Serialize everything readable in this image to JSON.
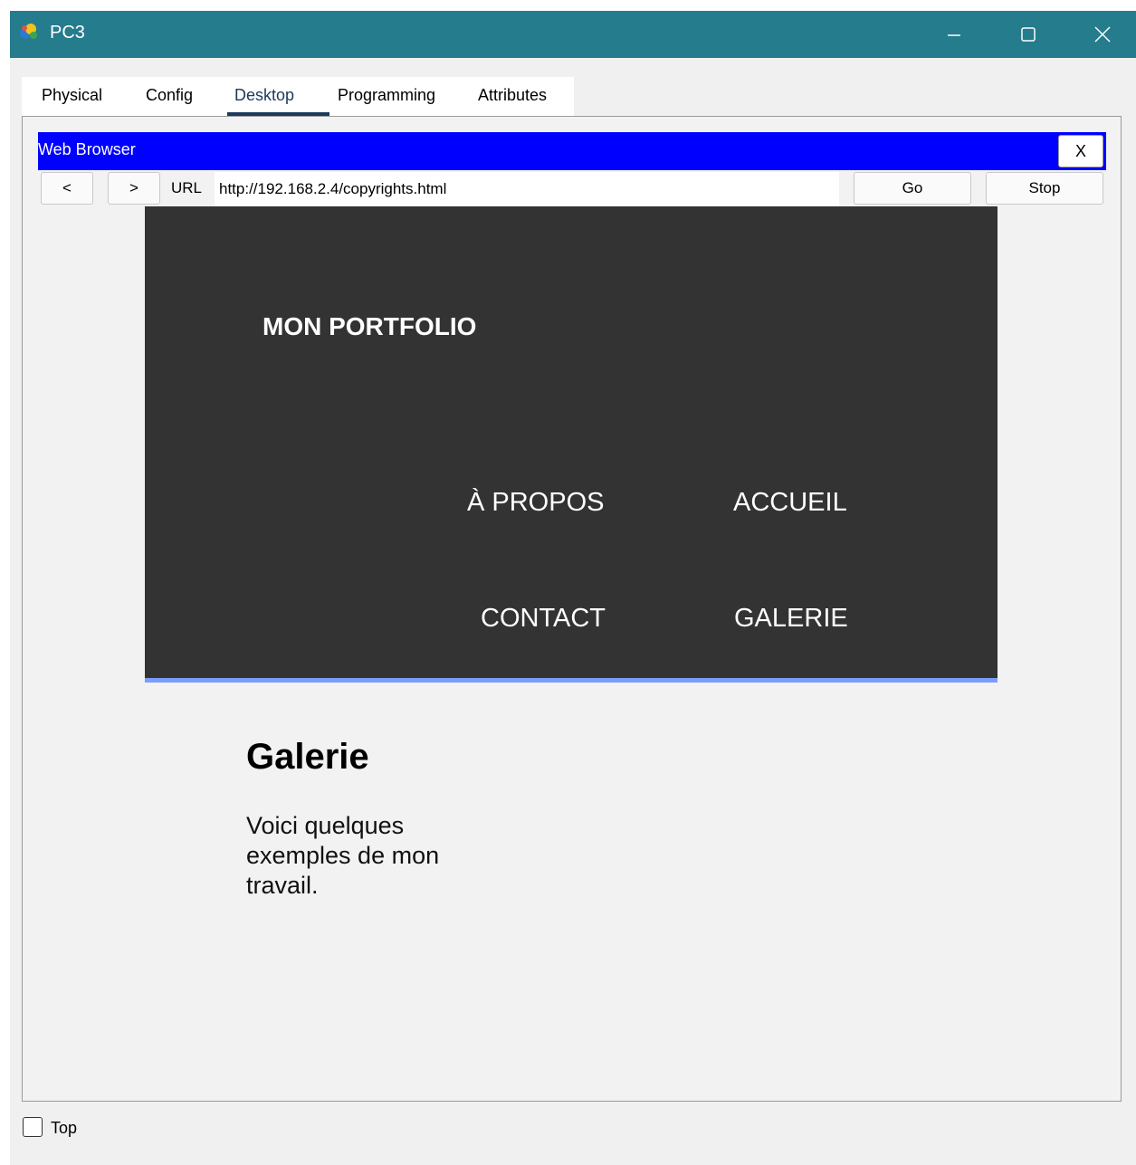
{
  "window": {
    "title": "PC3",
    "controls": {
      "minimize": "—",
      "maximize": "☐",
      "close": "✕"
    }
  },
  "tabs": [
    {
      "label": "Physical"
    },
    {
      "label": "Config"
    },
    {
      "label": "Desktop",
      "active": true
    },
    {
      "label": "Programming"
    },
    {
      "label": "Attributes"
    }
  ],
  "browser": {
    "title": "Web Browser",
    "close_label": "X",
    "back_label": "<",
    "forward_label": ">",
    "url_label": "URL",
    "url_value": "http://192.168.2.4/copyrights.html",
    "go_label": "Go",
    "stop_label": "Stop"
  },
  "site": {
    "logo": "MON PORTFOLIO",
    "nav": [
      "À PROPOS",
      "ACCUEIL",
      "CONTACT",
      "GALERIE"
    ],
    "heading": "Galerie",
    "text": "Voici quelques exemples de mon travail."
  },
  "footer": {
    "top_label": "Top"
  },
  "colors": {
    "titlebar": "#247c8d",
    "browser_header": "#0000ff",
    "site_header": "#333333",
    "site_header_border": "#7a9cff",
    "active_tab": "#1b3a5c"
  }
}
